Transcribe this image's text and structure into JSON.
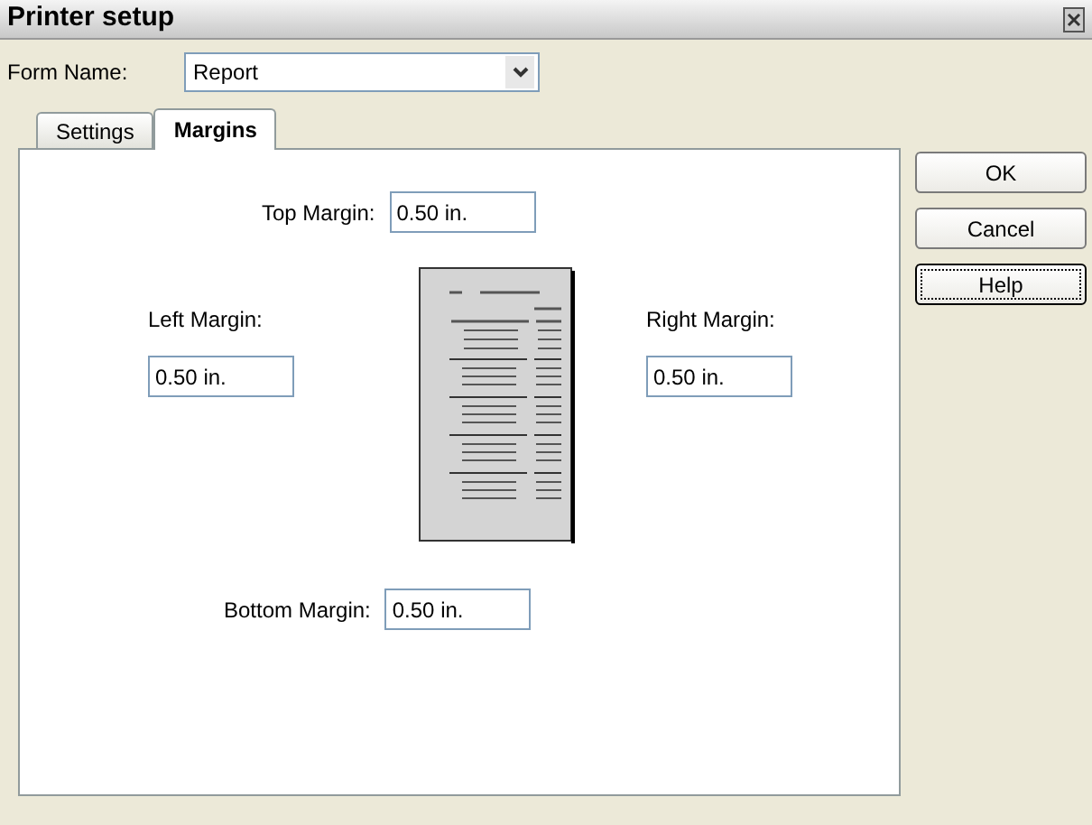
{
  "window": {
    "title": "Printer setup"
  },
  "form_name": {
    "label": "Form Name:",
    "value": "Report"
  },
  "tabs": [
    {
      "label": "Settings",
      "selected": false
    },
    {
      "label": "Margins",
      "selected": true
    }
  ],
  "margins": {
    "top": {
      "label": "Top Margin:",
      "value": "0.50 in."
    },
    "left": {
      "label": "Left Margin:",
      "value": "0.50 in."
    },
    "right": {
      "label": "Right Margin:",
      "value": "0.50 in."
    },
    "bottom": {
      "label": "Bottom Margin:",
      "value": "0.50 in."
    }
  },
  "buttons": [
    {
      "label": "OK",
      "focused": false
    },
    {
      "label": "Cancel",
      "focused": false
    },
    {
      "label": "Help",
      "focused": true
    }
  ]
}
